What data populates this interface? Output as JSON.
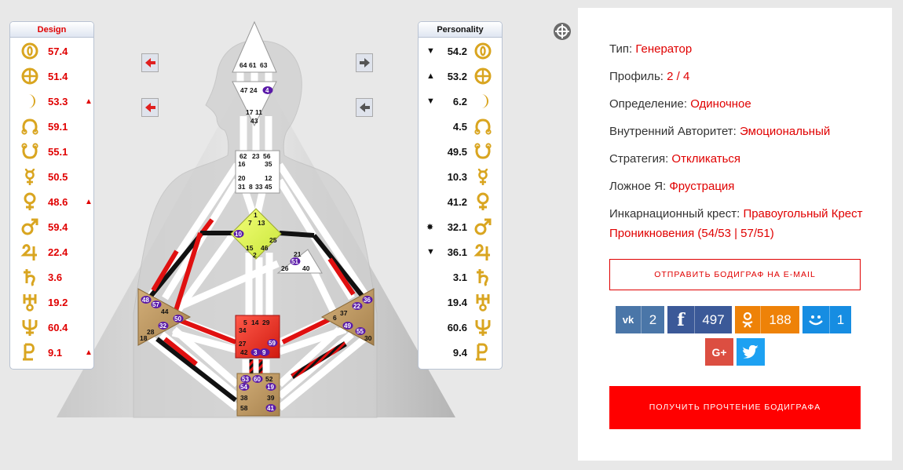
{
  "design": {
    "title": "Design",
    "rows": [
      {
        "planet": "sun-icon",
        "value": "57.4",
        "arrow": ""
      },
      {
        "planet": "earth-icon",
        "value": "51.4",
        "arrow": ""
      },
      {
        "planet": "moon-icon",
        "value": "53.3",
        "arrow": "▲"
      },
      {
        "planet": "north-node-icon",
        "value": "59.1",
        "arrow": ""
      },
      {
        "planet": "south-node-icon",
        "value": "55.1",
        "arrow": ""
      },
      {
        "planet": "mercury-icon",
        "value": "50.5",
        "arrow": ""
      },
      {
        "planet": "venus-icon",
        "value": "48.6",
        "arrow": "▲"
      },
      {
        "planet": "mars-icon",
        "value": "59.4",
        "arrow": ""
      },
      {
        "planet": "jupiter-icon",
        "value": "22.4",
        "arrow": ""
      },
      {
        "planet": "saturn-icon",
        "value": "3.6",
        "arrow": ""
      },
      {
        "planet": "uranus-icon",
        "value": "19.2",
        "arrow": ""
      },
      {
        "planet": "neptune-icon",
        "value": "60.4",
        "arrow": ""
      },
      {
        "planet": "pluto-icon",
        "value": "9.1",
        "arrow": "▲"
      }
    ]
  },
  "personality": {
    "title": "Personality",
    "rows": [
      {
        "planet": "sun-icon",
        "value": "54.2",
        "arrow": "▼"
      },
      {
        "planet": "earth-icon",
        "value": "53.2",
        "arrow": "▲"
      },
      {
        "planet": "moon-icon",
        "value": "6.2",
        "arrow": "▼"
      },
      {
        "planet": "north-node-icon",
        "value": "4.5",
        "arrow": ""
      },
      {
        "planet": "south-node-icon",
        "value": "49.5",
        "arrow": ""
      },
      {
        "planet": "mercury-icon",
        "value": "10.3",
        "arrow": ""
      },
      {
        "planet": "venus-icon",
        "value": "41.2",
        "arrow": ""
      },
      {
        "planet": "mars-icon",
        "value": "32.1",
        "arrow": "✸"
      },
      {
        "planet": "jupiter-icon",
        "value": "36.1",
        "arrow": "▼"
      },
      {
        "planet": "saturn-icon",
        "value": "3.1",
        "arrow": ""
      },
      {
        "planet": "uranus-icon",
        "value": "19.4",
        "arrow": ""
      },
      {
        "planet": "neptune-icon",
        "value": "60.6",
        "arrow": ""
      },
      {
        "planet": "pluto-icon",
        "value": "9.4",
        "arrow": ""
      }
    ]
  },
  "colors": {
    "accent": "#e00000",
    "glyph": "#d9a520",
    "design_channel": "#e01010",
    "personality_channel": "#111111",
    "vk": "#4a76a8",
    "facebook": "#3b5998",
    "ok": "#ee8208",
    "moimir": "#168de2",
    "gplus": "#dc4e41",
    "twitter": "#1da1f2"
  },
  "gates": {
    "head": [
      "64",
      "61",
      "63"
    ],
    "ajna": [
      "47",
      "24",
      "4",
      "17",
      "11",
      "43"
    ],
    "throat": [
      "62",
      "23",
      "56",
      "16",
      "35",
      "20",
      "12",
      "31",
      "8",
      "33",
      "45"
    ],
    "g": [
      "1",
      "7",
      "13",
      "10",
      "25",
      "15",
      "46",
      "2"
    ],
    "ego": [
      "21",
      "51",
      "26",
      "40"
    ],
    "sacral": [
      "5",
      "14",
      "29",
      "34",
      "27",
      "59",
      "42",
      "3",
      "9"
    ],
    "spleen": [
      "48",
      "57",
      "44",
      "50",
      "32",
      "28",
      "18"
    ],
    "solar": [
      "36",
      "22",
      "37",
      "6",
      "49",
      "55",
      "30"
    ],
    "root": [
      "53",
      "60",
      "52",
      "54",
      "19",
      "38",
      "39",
      "58",
      "41"
    ]
  },
  "info": {
    "type_label": "Тип:",
    "type_value": "Генератор",
    "profile_label": "Профиль:",
    "profile_value": "2 / 4",
    "definition_label": "Определение:",
    "definition_value": "Одиночное",
    "authority_label": "Внутренний Авторитет:",
    "authority_value": "Эмоциональный",
    "strategy_label": "Стратегия:",
    "strategy_value": "Откликаться",
    "notself_label": "Ложное Я:",
    "notself_value": "Фрустрация",
    "cross_label": "Инкарнационный крест:",
    "cross_value": "Правоугольный Крест Проникновения (54/53 | 57/51)"
  },
  "buttons": {
    "email": "ОТПРАВИТЬ БОДИГРАФ НА E-MAIL",
    "reading": "ПОЛУЧИТЬ ПРОЧТЕНИЕ БОДИГРАФА"
  },
  "share": {
    "vk_count": "2",
    "fb_count": "497",
    "ok_count": "188",
    "mm_count": "1"
  }
}
